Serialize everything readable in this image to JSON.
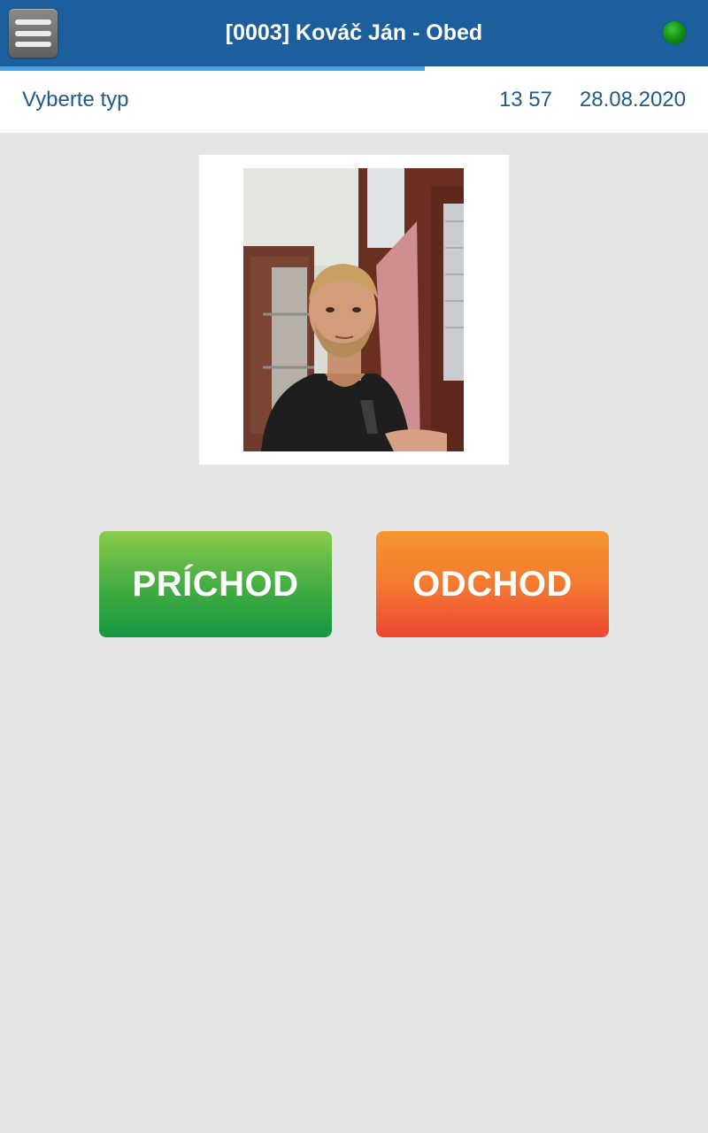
{
  "header": {
    "title": "[0003] Kováč Ján - Obed",
    "menu_icon": "hamburger-menu-icon",
    "status": "online",
    "status_color": "#0f8a10",
    "accent_color": "#1d5e9c"
  },
  "progress": {
    "fraction": 0.6,
    "color": "#4aa3e6"
  },
  "info": {
    "prompt": "Vyberte typ",
    "time": "13 57",
    "date": "28.08.2020",
    "text_color": "#1f5a8a"
  },
  "actions": {
    "arrival_label": "PRÍCHOD",
    "departure_label": "ODCHOD",
    "arrival_color": "#149740",
    "departure_color": "#ee4634"
  }
}
